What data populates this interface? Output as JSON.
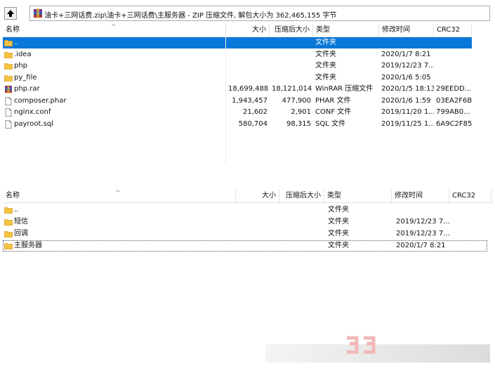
{
  "path_bar": {
    "text": "油卡+三网话费.zip\\油卡+三网话费\\主服务器 - ZIP 压缩文件, 解包大小为 362,465,155 字节"
  },
  "top_panel": {
    "columns": [
      "名称",
      "大小",
      "压缩后大小",
      "类型",
      "修改时间",
      "CRC32"
    ],
    "rows": [
      {
        "name": "..",
        "size": "",
        "packed": "",
        "type": "文件夹",
        "modified": "",
        "crc": "",
        "icon": "folder-icon",
        "selected": true
      },
      {
        "name": ".idea",
        "size": "",
        "packed": "",
        "type": "文件夹",
        "modified": "2020/1/7 8:21",
        "crc": "",
        "icon": "folder-icon"
      },
      {
        "name": "php",
        "size": "",
        "packed": "",
        "type": "文件夹",
        "modified": "2019/12/23 7...",
        "crc": "",
        "icon": "folder-icon"
      },
      {
        "name": "py_file",
        "size": "",
        "packed": "",
        "type": "文件夹",
        "modified": "2020/1/6 5:05",
        "crc": "",
        "icon": "folder-icon"
      },
      {
        "name": "php.rar",
        "size": "18,699,488",
        "packed": "18,121,014",
        "type": "WinRAR 压缩文件",
        "modified": "2020/1/5 18:13",
        "crc": "29EEDD...",
        "icon": "rar-icon"
      },
      {
        "name": "composer.phar",
        "size": "1,943,457",
        "packed": "477,900",
        "type": "PHAR 文件",
        "modified": "2020/1/6 1:59",
        "crc": "03EA2F6B",
        "icon": "file-icon"
      },
      {
        "name": "nginx.conf",
        "size": "21,602",
        "packed": "2,901",
        "type": "CONF 文件",
        "modified": "2019/11/20 1...",
        "crc": "799AB0...",
        "icon": "file-icon"
      },
      {
        "name": "payroot.sql",
        "size": "580,704",
        "packed": "98,315",
        "type": "SQL 文件",
        "modified": "2019/11/25 1...",
        "crc": "6A9C2F85",
        "icon": "file-icon"
      }
    ]
  },
  "bottom_panel": {
    "columns": [
      "名称",
      "大小",
      "压缩后大小",
      "类型",
      "修改时间",
      "CRC32"
    ],
    "rows": [
      {
        "name": "..",
        "type": "文件夹",
        "modified": "",
        "icon": "folder-icon"
      },
      {
        "name": "短信",
        "type": "文件夹",
        "modified": "2019/12/23 7...",
        "icon": "folder-icon"
      },
      {
        "name": "回调",
        "type": "文件夹",
        "modified": "2019/12/23 7...",
        "icon": "folder-icon"
      },
      {
        "name": "主服务器",
        "type": "文件夹",
        "modified": "2020/1/7 8:21",
        "icon": "folder-icon",
        "focused": true
      }
    ]
  },
  "colors": {
    "selection": "#0a78d7",
    "folder": "#f5c242"
  }
}
